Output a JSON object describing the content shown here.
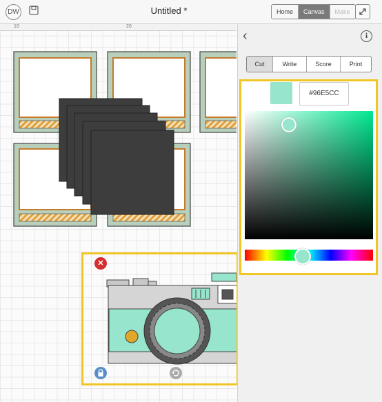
{
  "header": {
    "avatar_initials": "DW",
    "title": "Untitled *",
    "segments": [
      "Home",
      "Canvas",
      "Make"
    ],
    "active_segment": "Canvas",
    "icons": [
      "save-icon",
      "expand-icon"
    ]
  },
  "ruler": {
    "ticks": [
      "10",
      "20"
    ]
  },
  "panel": {
    "tabs": [
      "Cut",
      "Write",
      "Score",
      "Print"
    ],
    "active_tab": "Cut",
    "color": {
      "hex": "#96E5CC",
      "hue_position": 0.45
    },
    "icons": [
      "back-chevron-icon",
      "info-icon"
    ]
  },
  "selection": {
    "icons": [
      "delete-icon",
      "lock-icon",
      "rotate-icon"
    ]
  },
  "colors": {
    "accent": "#f1c524",
    "selected_color": "#96E5CC",
    "frame_green": "#b7cfbb",
    "frame_orange": "#e0a040",
    "card_dark": "#3d3d3d"
  }
}
